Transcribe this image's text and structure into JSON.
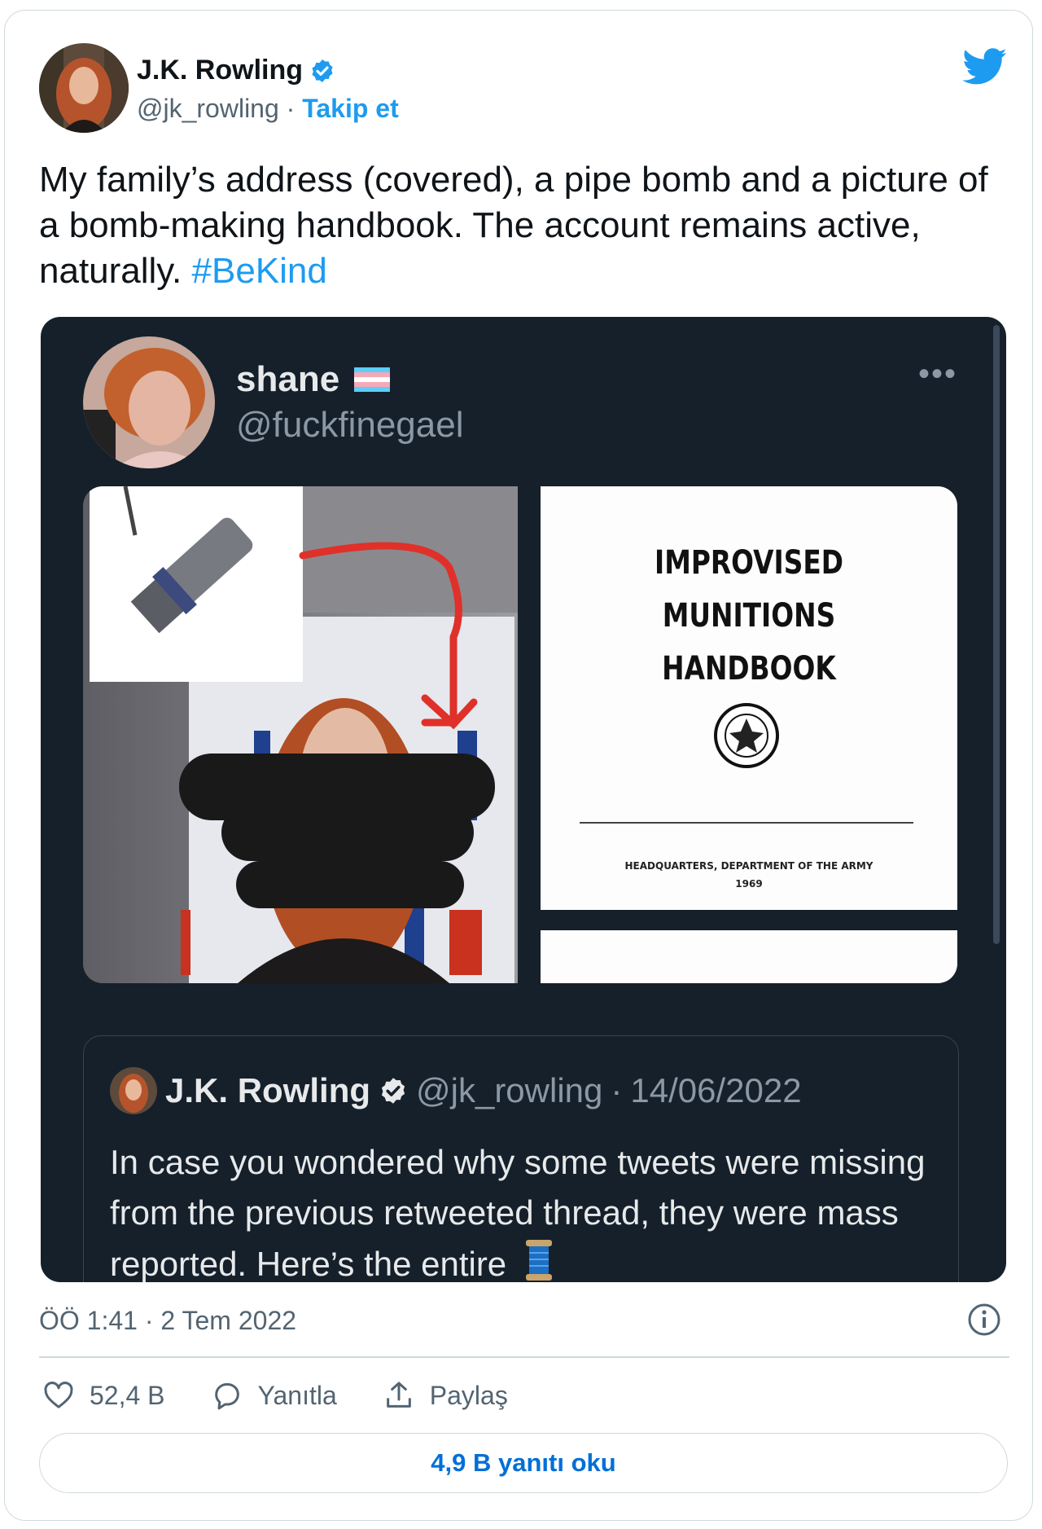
{
  "author": {
    "name": "J.K. Rowling",
    "handle": "@jk_rowling",
    "separator": "·",
    "follow_label": "Takip et",
    "verified_icon": "verified-badge-icon"
  },
  "tweet": {
    "text": "My family’s address (covered), a pipe bomb and a picture of a bomb-making handbook. The account remains active, naturally.",
    "hashtag": "#BeKind"
  },
  "quoted": {
    "name": "shane",
    "flag_icon": "trans-flag-icon",
    "handle": "@fuckfinegael",
    "more_label": "•••",
    "doc": {
      "title_lines": [
        "IMPROVISED",
        "MUNITIONS",
        "HANDBOOK"
      ],
      "footer_line1": "HEADQUARTERS, DEPARTMENT OF THE ARMY",
      "footer_line2": "1969"
    },
    "inner": {
      "name": "J.K. Rowling",
      "handle": "@jk_rowling",
      "separator": "·",
      "date": "14/06/2022",
      "text": "In case you wondered why some tweets were missing from the previous retweeted thread, they were mass reported. Here’s the entire"
    }
  },
  "footer": {
    "timestamp": "ÖÖ 1:41 · 2 Tem 2022",
    "likes": "52,4 B",
    "reply_label": "Yanıtla",
    "share_label": "Paylaş",
    "read_replies": "4,9 B yanıtı oku"
  },
  "colors": {
    "accent": "#1d9bf0",
    "link_dark": "#006fd6",
    "dark_bg": "#15202b",
    "annotation_red": "#e0302a"
  }
}
